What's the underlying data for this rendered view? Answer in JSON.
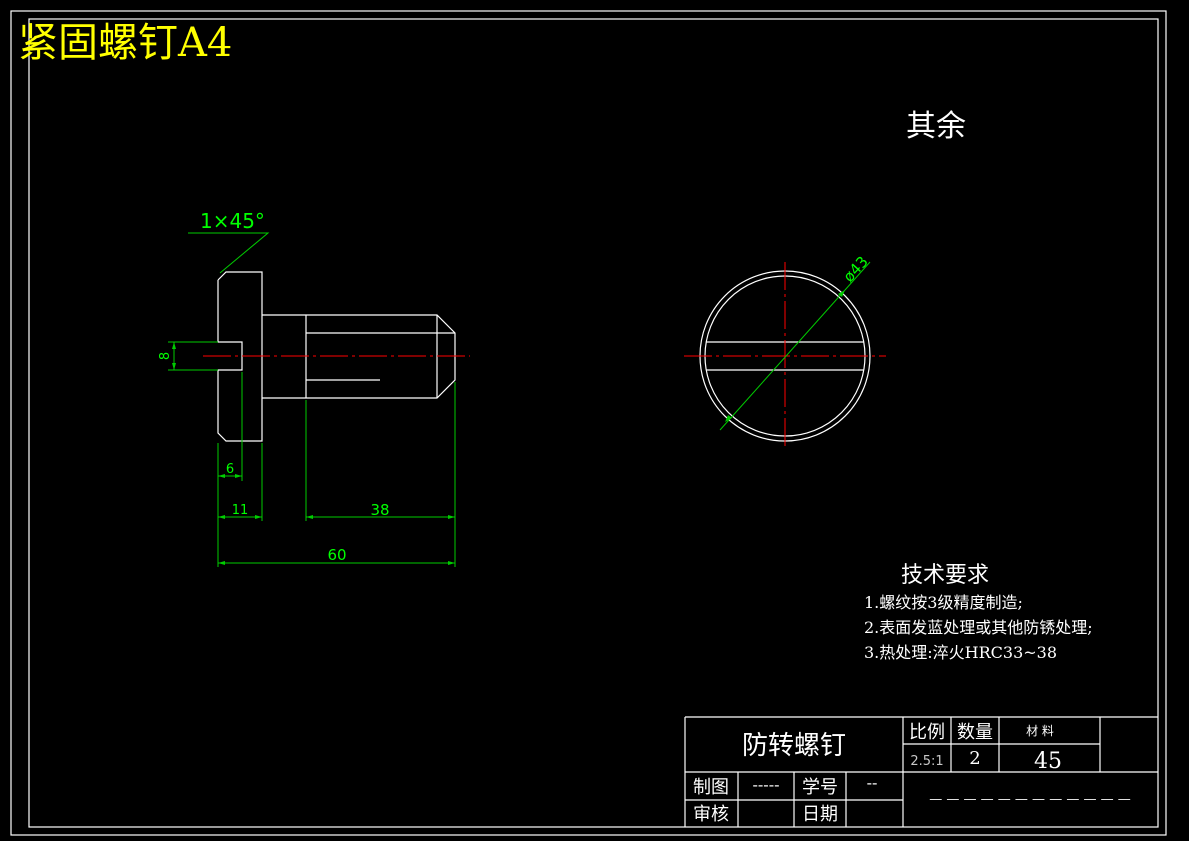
{
  "title": "紧固螺钉A4",
  "roughness_note": "其余",
  "dimensions": {
    "chamfer": "1×45°",
    "diameter_label": "8",
    "head_thickness": "6",
    "shoulder_length": "11",
    "thread_length": "38",
    "total_length": "60",
    "end_view_diameter": "ø43"
  },
  "tech_requirements": {
    "heading": "技术要求",
    "items": [
      "1.螺纹按3级精度制造;",
      "2.表面发蓝处理或其他防锈处理;",
      "3.热处理:淬火HRC33~38"
    ]
  },
  "title_block": {
    "part_name": "防转螺钉",
    "scale_label": "比例",
    "scale_value": "2.5:1",
    "quantity_label": "数量",
    "quantity_value": "2",
    "material_label": "材  料",
    "material_value": "45",
    "drawn_label": "制图",
    "drawn_value": "-----",
    "student_no_label": "学号",
    "student_no_value": "--",
    "checked_label": "审核",
    "date_label": "日期",
    "blank_line": "— — — — — — — — — — — —"
  },
  "colors": {
    "background": "#000000",
    "outline": "#ffffff",
    "dimension": "#00ff00",
    "centerline": "#ff0000",
    "title": "#ffff00"
  }
}
